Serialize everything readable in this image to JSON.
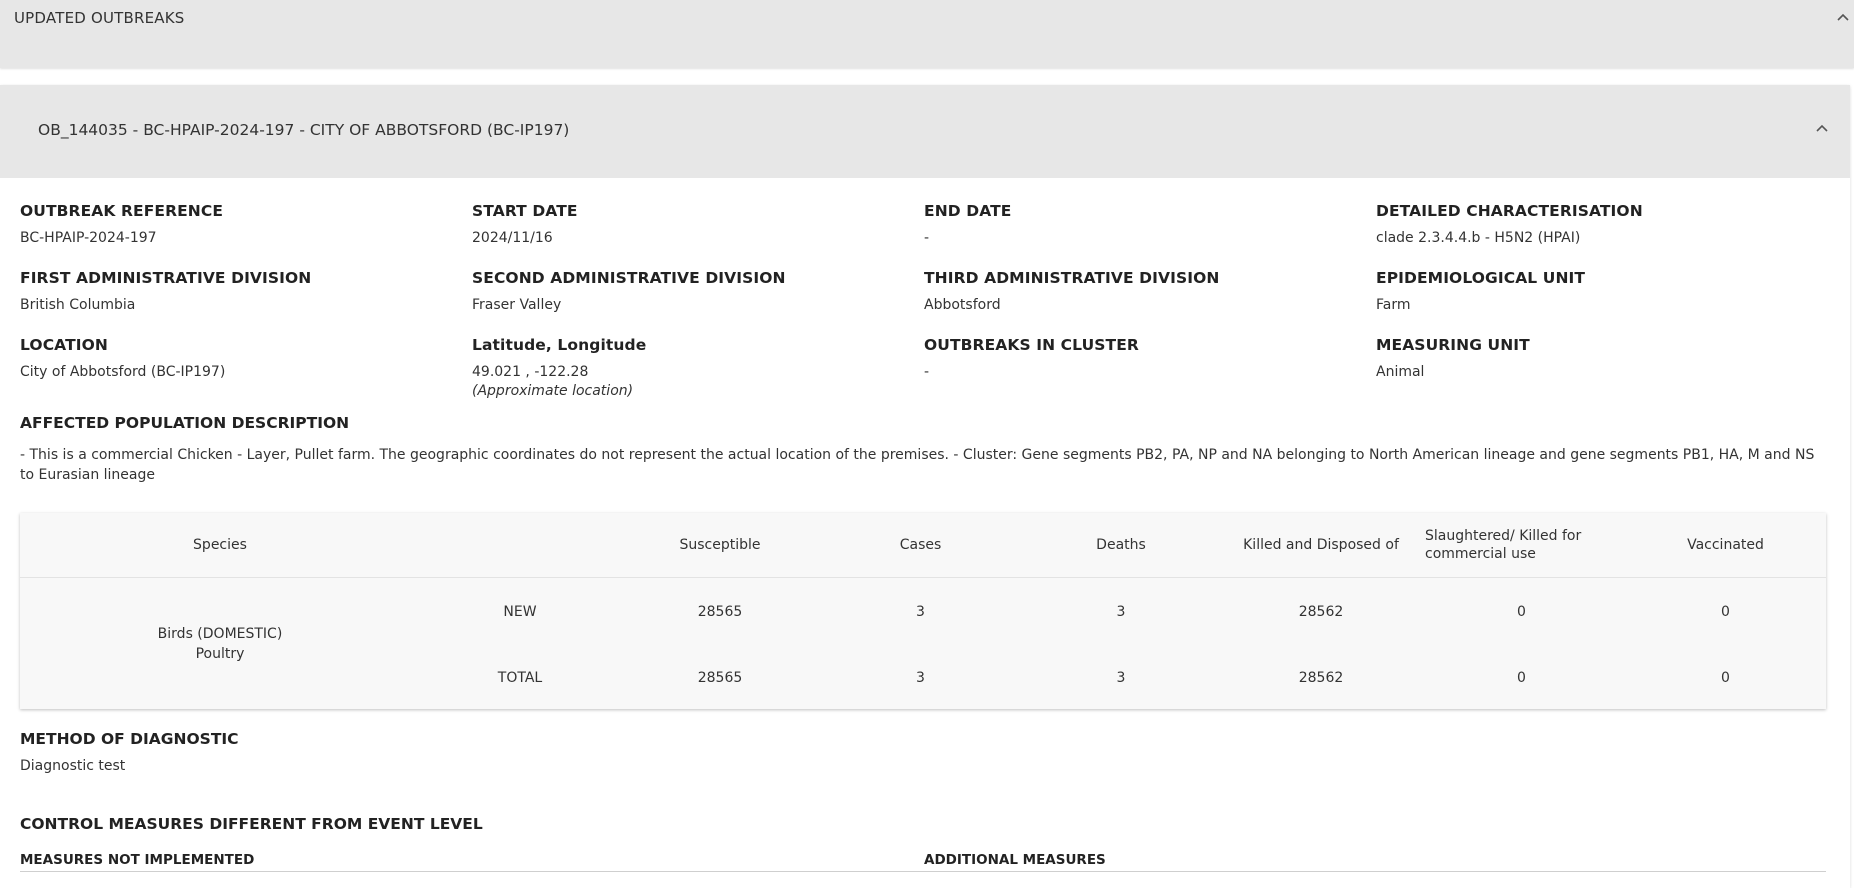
{
  "top_panel": {
    "title": "UPDATED OUTBREAKS"
  },
  "outbreak": {
    "title": "OB_144035 - BC-HPAIP-2024-197 - CITY OF ABBOTSFORD (BC-IP197)",
    "fields": {
      "outbreak_reference": {
        "label": "OUTBREAK REFERENCE",
        "value": "BC-HPAIP-2024-197"
      },
      "start_date": {
        "label": "START DATE",
        "value": "2024/11/16"
      },
      "end_date": {
        "label": "END DATE",
        "value": "-"
      },
      "detailed_characterisation": {
        "label": "DETAILED CHARACTERISATION",
        "value": "clade 2.3.4.4.b - H5N2 (HPAI)"
      },
      "first_admin_division": {
        "label": "FIRST ADMINISTRATIVE DIVISION",
        "value": "British Columbia"
      },
      "second_admin_division": {
        "label": "SECOND ADMINISTRATIVE DIVISION",
        "value": "Fraser Valley"
      },
      "third_admin_division": {
        "label": "THIRD ADMINISTRATIVE DIVISION",
        "value": "Abbotsford"
      },
      "epidemiological_unit": {
        "label": "EPIDEMIOLOGICAL UNIT",
        "value": "Farm"
      },
      "location": {
        "label": "LOCATION",
        "value": "City of Abbotsford (BC-IP197)"
      },
      "lat_long": {
        "label": "Latitude, Longitude",
        "value": "49.021 , -122.28",
        "note": "(Approximate location)"
      },
      "outbreaks_in_cluster": {
        "label": "OUTBREAKS IN CLUSTER",
        "value": "-"
      },
      "measuring_unit": {
        "label": "MEASURING UNIT",
        "value": "Animal"
      }
    },
    "affected_population": {
      "label": "AFFECTED POPULATION DESCRIPTION",
      "text": "- This is a commercial Chicken - Layer, Pullet farm. The geographic coordinates do not represent the actual location of the premises. - Cluster: Gene segments PB2, PA, NP and NA belonging to North American lineage and gene segments PB1, HA, M and NS to Eurasian lineage"
    },
    "table": {
      "headers": {
        "species": "Species",
        "susceptible": "Susceptible",
        "cases": "Cases",
        "deaths": "Deaths",
        "killed": "Killed and Disposed of",
        "slaughtered": "Slaughtered/ Killed for commercial use",
        "vaccinated": "Vaccinated"
      },
      "species_line1": "Birds (DOMESTIC)",
      "species_line2": "Poultry",
      "rows": [
        {
          "type": "NEW",
          "susceptible": "28565",
          "cases": "3",
          "deaths": "3",
          "killed": "28562",
          "slaughtered": "0",
          "vaccinated": "0"
        },
        {
          "type": "TOTAL",
          "susceptible": "28565",
          "cases": "3",
          "deaths": "3",
          "killed": "28562",
          "slaughtered": "0",
          "vaccinated": "0"
        }
      ]
    },
    "method_of_diagnostic": {
      "label": "METHOD OF DIAGNOSTIC",
      "value": "Diagnostic test"
    },
    "control_measures": {
      "label": "CONTROL MEASURES DIFFERENT FROM EVENT LEVEL",
      "not_implemented": "MEASURES NOT IMPLEMENTED",
      "additional": "ADDITIONAL MEASURES"
    }
  }
}
